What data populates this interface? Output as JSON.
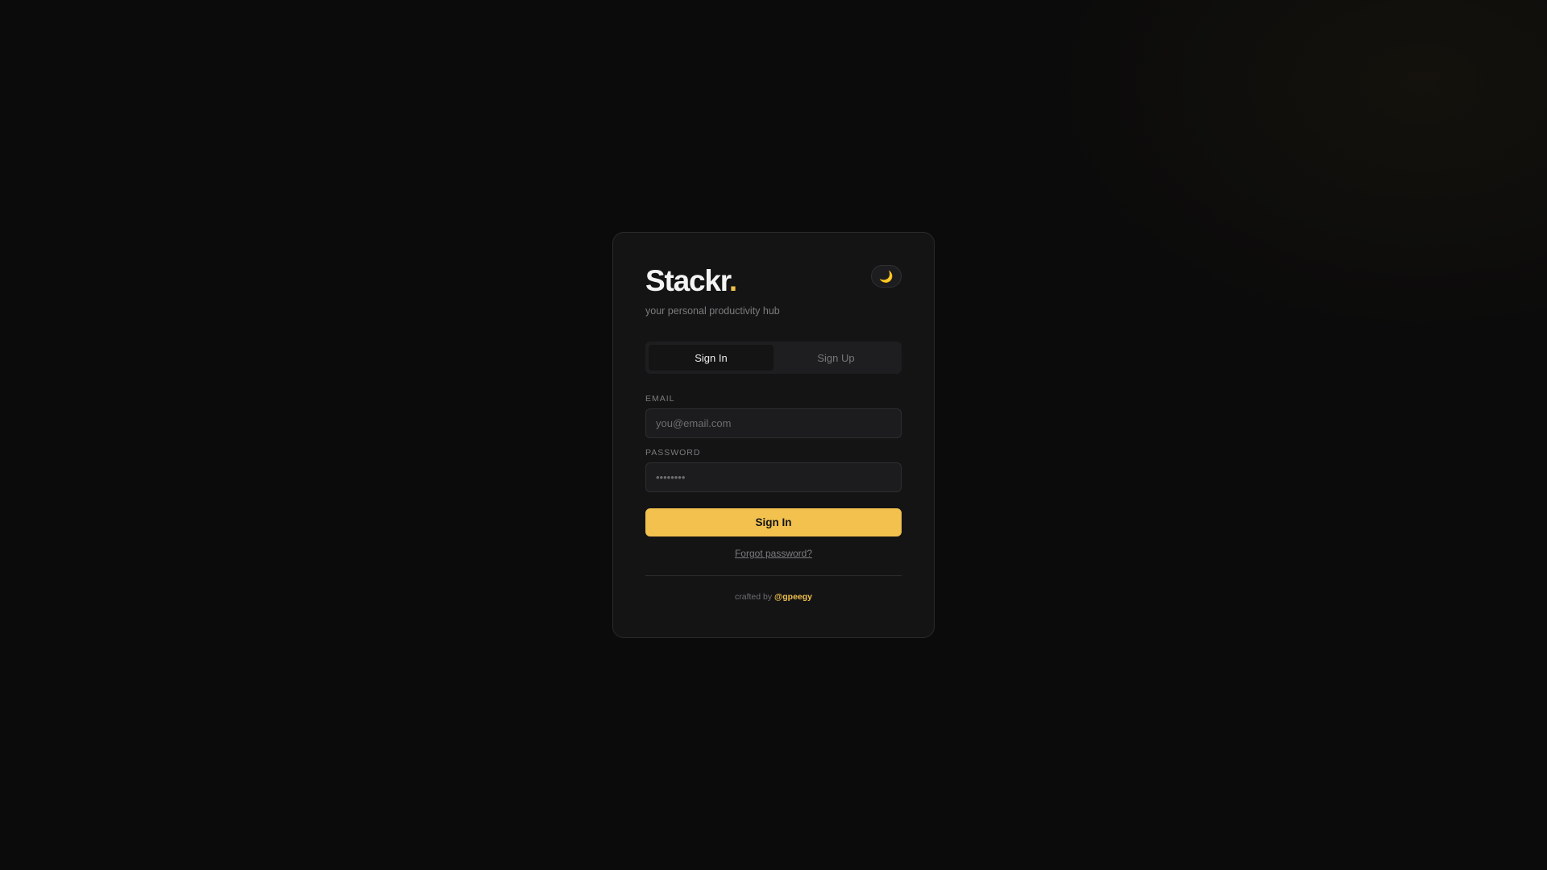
{
  "app": {
    "name": "Stackr",
    "name_dot": ".",
    "tagline": "your personal productivity hub"
  },
  "theme_toggle": {
    "icon": "moon-icon",
    "glyph": "🌙"
  },
  "tabs": [
    {
      "label": "Sign In",
      "active": true
    },
    {
      "label": "Sign Up",
      "active": false
    }
  ],
  "form": {
    "email_label": "EMAIL",
    "email_placeholder": "you@email.com",
    "email_value": "",
    "password_label": "PASSWORD",
    "password_placeholder": "••••••••",
    "password_value": "",
    "submit_label": "Sign In",
    "forgot_label": "Forgot password?"
  },
  "footer": {
    "prefix": "crafted by",
    "handle": "@gpeegy"
  },
  "colors": {
    "accent": "#f2c14e",
    "background": "#0b0b0b",
    "card": "#141415"
  }
}
